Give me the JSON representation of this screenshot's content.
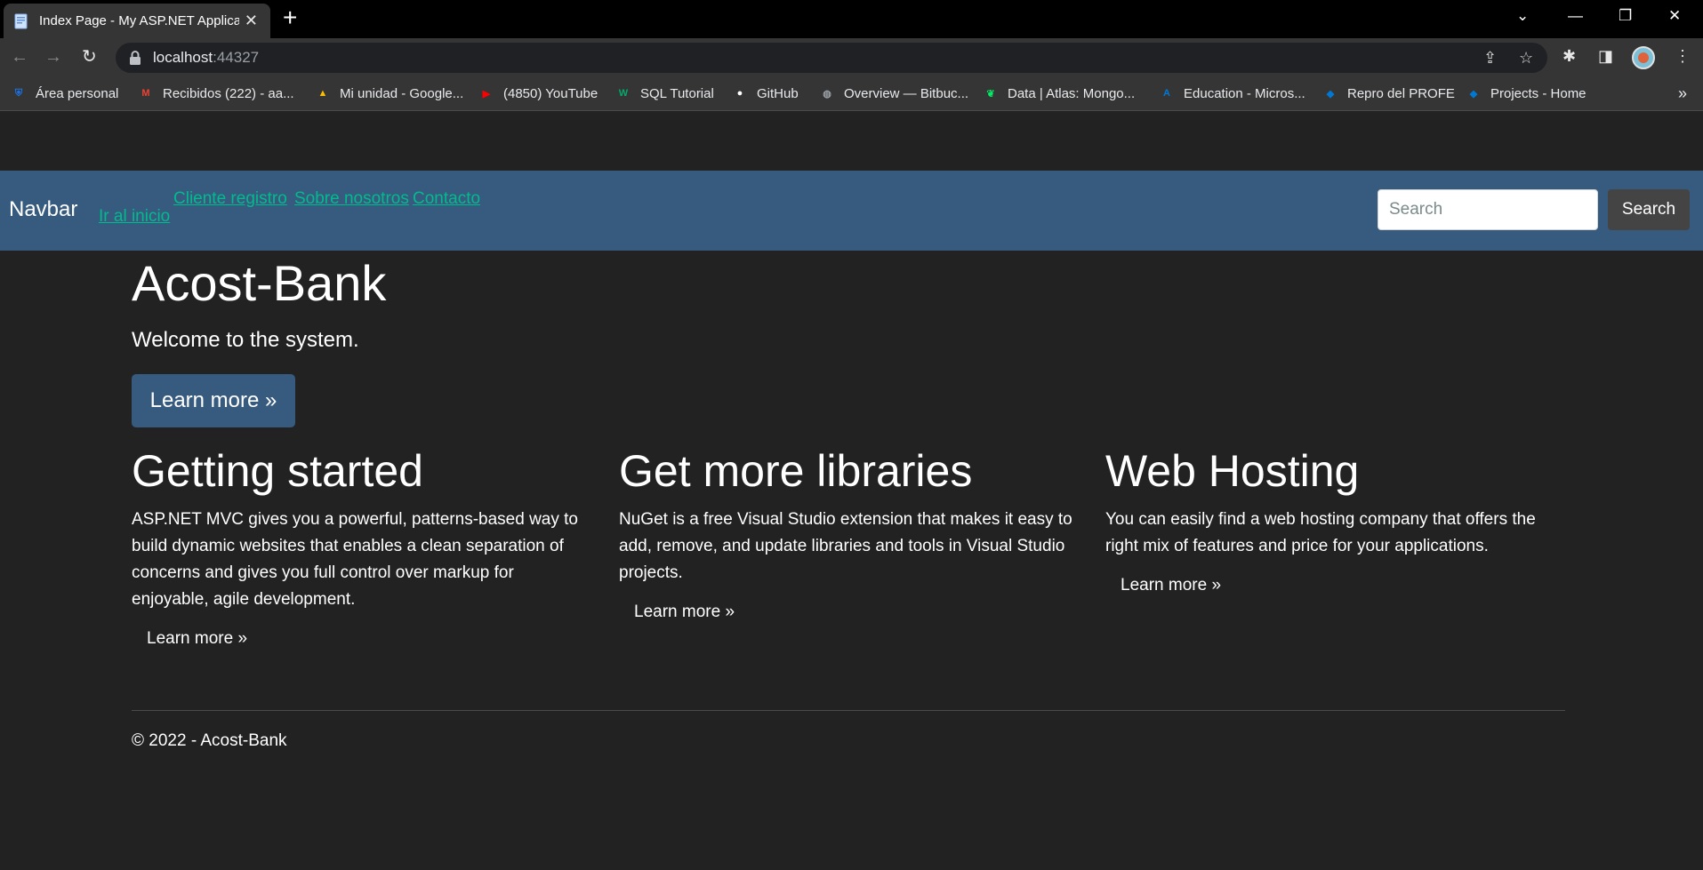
{
  "browser": {
    "tab_title": "Index Page - My ASP.NET Application",
    "tab_close": "✕",
    "new_tab": "+",
    "url_host": "localhost",
    "url_port": ":44327",
    "bookmarks": [
      {
        "label": "Área personal",
        "icon": "shield-icon",
        "color": "#1a73e8"
      },
      {
        "label": "Recibidos (222) - aa...",
        "icon": "gmail-icon",
        "color": "#ea4335"
      },
      {
        "label": "Mi unidad - Google...",
        "icon": "google-drive-icon",
        "color": "#fbbc04"
      },
      {
        "label": "(4850) YouTube",
        "icon": "youtube-icon",
        "color": "#ff0000"
      },
      {
        "label": "SQL Tutorial",
        "icon": "w3schools-icon",
        "color": "#04aa6d"
      },
      {
        "label": "GitHub",
        "icon": "github-icon",
        "color": "#ffffff"
      },
      {
        "label": "Overview — Bitbuc...",
        "icon": "globe-icon",
        "color": "#9aa0a6"
      },
      {
        "label": "Data | Atlas: Mongo...",
        "icon": "mongodb-icon",
        "color": "#00ed64"
      },
      {
        "label": "Education - Micros...",
        "icon": "azure-icon",
        "color": "#0078d4"
      },
      {
        "label": "Repro del PROFE",
        "icon": "azure-devops-icon",
        "color": "#0078d4"
      },
      {
        "label": "Projects - Home",
        "icon": "azure-devops-icon",
        "color": "#0078d4"
      }
    ],
    "bookmarks_more": "»"
  },
  "site": {
    "brand": "Navbar",
    "nav_links": [
      "Ir al inicio",
      "Cliente registro",
      "Sobre nosotros",
      "Contacto"
    ],
    "search_placeholder": "Search",
    "search_button": "Search",
    "hero": {
      "title": "Acost-Bank",
      "lead": "Welcome to the system.",
      "button": "Learn more »"
    },
    "columns": [
      {
        "title": "Getting started",
        "text": "ASP.NET MVC gives you a powerful, patterns-based way to build dynamic websites that enables a clean separation of concerns and gives you full control over markup for enjoyable, agile development.",
        "link": "Learn more »"
      },
      {
        "title": "Get more libraries",
        "text": "NuGet is a free Visual Studio extension that makes it easy to add, remove, and update libraries and tools in Visual Studio projects.",
        "link": "Learn more »"
      },
      {
        "title": "Web Hosting",
        "text": "You can easily find a web hosting company that offers the right mix of features and price for your applications.",
        "link": "Learn more »"
      }
    ],
    "footer": "© 2022 - Acost-Bank"
  },
  "colors": {
    "page_bg": "#222222",
    "navbar_bg": "#375a7f",
    "link": "#00bc8c"
  }
}
